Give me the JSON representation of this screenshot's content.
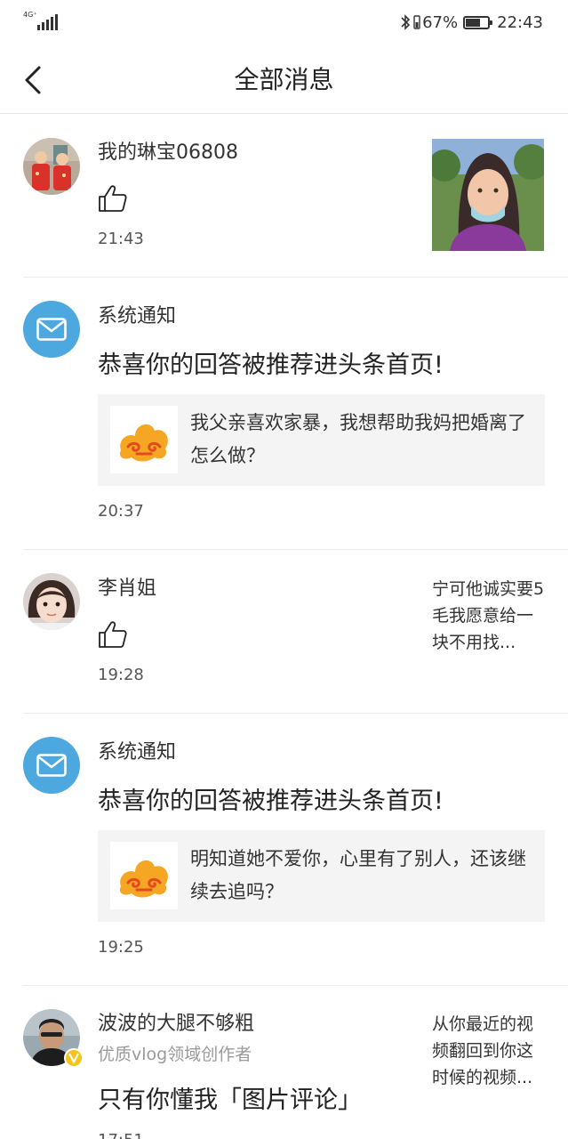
{
  "status_bar": {
    "network": "4G⁺",
    "sub_network": "1k",
    "battery_pct_text": "67%",
    "battery_level": 0.67,
    "time": "22:43"
  },
  "nav": {
    "title": "全部消息",
    "back_icon": "chevron-left-icon"
  },
  "messages": [
    {
      "type": "like",
      "name": "我的琳宝06808",
      "icon": "thumbs-up-icon",
      "time": "21:43",
      "has_thumbnail": true
    },
    {
      "type": "system",
      "name": "系统通知",
      "headline": "恭喜你的回答被推荐进头条首页!",
      "quote": "我父亲喜欢家暴，我想帮助我妈把婚离了怎么做？",
      "time": "20:37"
    },
    {
      "type": "like",
      "name": "李肖姐",
      "icon": "thumbs-up-icon",
      "time": "19:28",
      "snippet": "宁可他诚实要5毛我愿意给一块不用找..."
    },
    {
      "type": "system",
      "name": "系统通知",
      "headline": "恭喜你的回答被推荐进头条首页!",
      "quote": "明知道她不爱你，心里有了别人，还该继续去追吗？",
      "time": "19:25"
    },
    {
      "type": "comment",
      "name": "波波的大腿不够粗",
      "subtitle": "优质vlog领域创作者",
      "headline": "只有你懂我「图片评论」",
      "time": "17:51",
      "snippet": "从你最近的视频翻回到你这时候的视频...",
      "badge": "verified-v-icon"
    }
  ],
  "colors": {
    "mail_blue": "#4ea8e0",
    "quote_bg": "#f4f4f4",
    "verified_yellow": "#f5c518"
  }
}
